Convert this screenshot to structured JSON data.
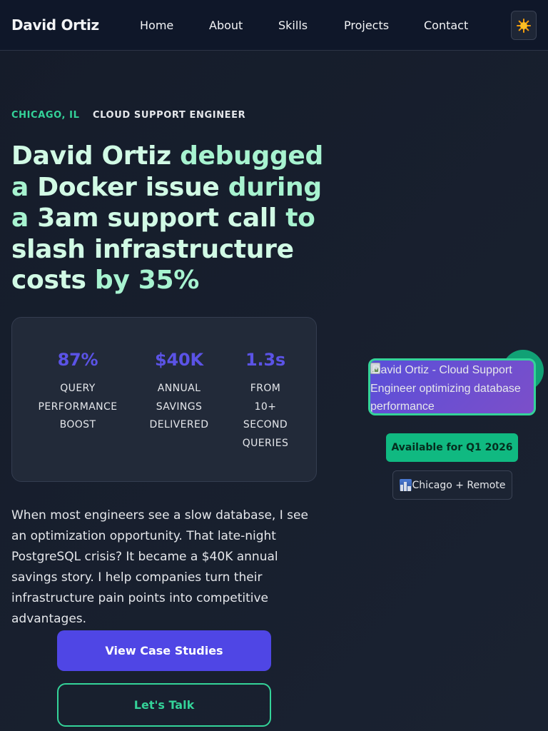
{
  "header": {
    "brand": "David Ortiz",
    "nav": [
      "Home",
      "About",
      "Skills",
      "Projects",
      "Contact"
    ],
    "theme_icon": "sun-icon"
  },
  "hero": {
    "location_label": "CHICAGO, IL",
    "role_label": "CLOUD SUPPORT ENGINEER",
    "headline_part1": "David Ortiz",
    "headline_part2": " debugged a ",
    "headline_part3": "Docker issue",
    "headline_part4": " during a ",
    "headline_part5": "3am support call",
    "headline_part6": " to ",
    "headline_part7": "slash infrastructure costs",
    "headline_part8": " by ",
    "headline_part9": "35%",
    "stats": [
      {
        "value": "87%",
        "label_lines": [
          "QUERY",
          "PERFORMANCE",
          "BOOST"
        ]
      },
      {
        "value": "$40K",
        "label_lines": [
          "ANNUAL",
          "SAVINGS",
          "DELIVERED"
        ]
      },
      {
        "value": "1.3s",
        "label_lines": [
          "FROM",
          "10+",
          "SECOND",
          "QUERIES"
        ]
      }
    ],
    "intro": "When most engineers see a slow database, I see an optimization opportunity. That late-night PostgreSQL crisis? It became a $40K annual savings story. I help companies turn their infrastructure pain points into competitive advantages.",
    "primary_cta": "View Case Studies",
    "secondary_cta": "Let's Talk"
  },
  "profile": {
    "image_alt": "David Ortiz - Cloud Support Engineer optimizing database performance",
    "availability": "Available for Q1 2026",
    "location": "Chicago + Remote",
    "location_icon": "cityscape-icon"
  },
  "colors": {
    "accent_purple": "#4f46e5",
    "accent_green": "#34d399",
    "header_bg": "#0f1729",
    "page_bg": "#161d2b"
  }
}
